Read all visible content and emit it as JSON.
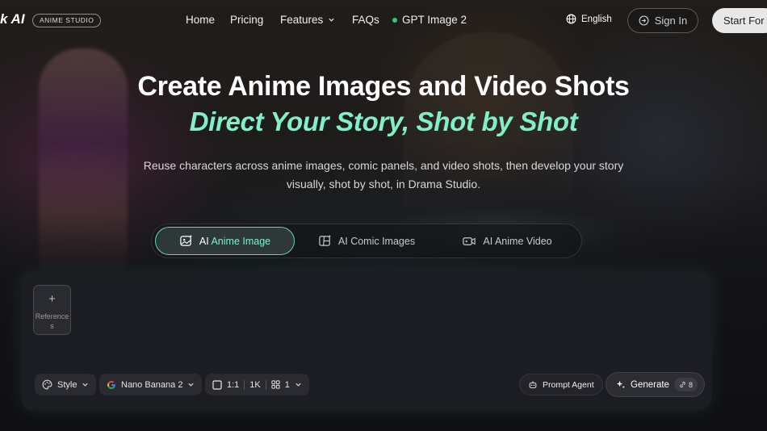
{
  "header": {
    "logo_text": "k AI",
    "logo_badge": "ANIME STUDIO",
    "nav": [
      {
        "label": "Home"
      },
      {
        "label": "Pricing"
      },
      {
        "label": "Features",
        "has_dropdown": true
      },
      {
        "label": "FAQs"
      },
      {
        "label": "GPT Image 2",
        "status_dot": "#2ecc71"
      }
    ],
    "language": "English",
    "sign_in": "Sign In",
    "start": "Start For"
  },
  "hero": {
    "title": "Create Anime Images and Video Shots",
    "subtitle": "Direct Your Story, Shot by Shot",
    "description": "Reuse characters across anime images, comic panels, and video shots, then develop your story visually, shot by shot, in Drama Studio."
  },
  "tabs": [
    {
      "label_prefix": "AI ",
      "label_highlight": "Anime Image",
      "icon": "image-sparkle-icon",
      "active": true
    },
    {
      "label": "AI Comic Images",
      "icon": "comic-panel-icon",
      "active": false
    },
    {
      "label": "AI Anime Video",
      "icon": "video-camera-icon",
      "active": false
    }
  ],
  "composer": {
    "references_label": "References",
    "style_label": "Style",
    "model_label": "Nano Banana 2",
    "aspect_ratio": "1:1",
    "resolution": "1K",
    "count": "1",
    "prompt_agent_label": "Prompt Agent",
    "generate_label": "Generate",
    "generate_credits": "8"
  },
  "colors": {
    "accent": "#7ff0c8",
    "active_border": "#5ad7b4",
    "status_green": "#2ecc71"
  }
}
